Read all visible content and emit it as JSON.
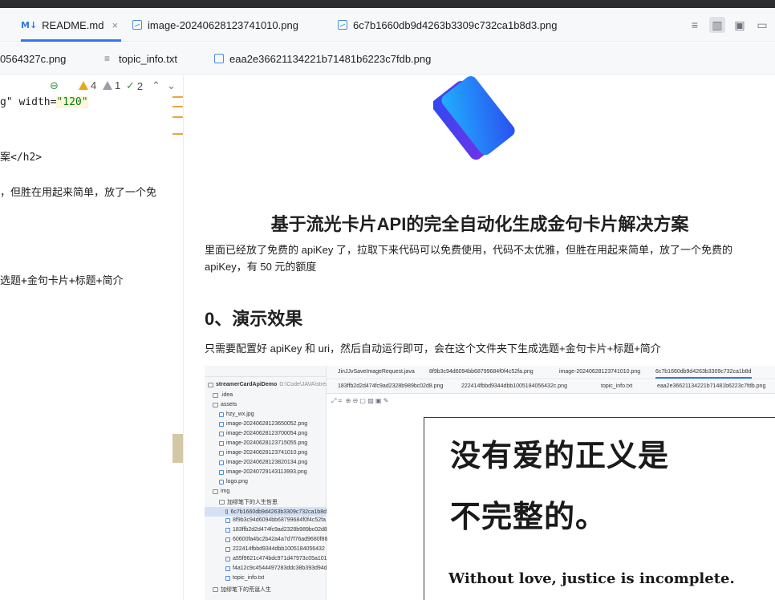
{
  "tabs_row1": [
    {
      "badge": "M↓",
      "label": "README.md",
      "close": "×",
      "active": true
    },
    {
      "label": "image-20240628123741010.png"
    },
    {
      "label": "6c7b1660db9d4263b3309c732ca1b8d3.png"
    }
  ],
  "tabs_row2": [
    {
      "label": "0564327c.png"
    },
    {
      "label": "topic_info.txt"
    },
    {
      "label": "eaa2e36621134221b71481b6223c7fdb.png"
    }
  ],
  "inspections": {
    "warnings": "4",
    "weak_warnings": "1",
    "ok": "2"
  },
  "editor_code": {
    "line1_pre": "g\" width=",
    "line1_str": "\"120\"",
    "line2": "案</h2>",
    "line3": "，但胜在用起来简单，放了一个免",
    "line4": "选题+金句卡片+标题+简介"
  },
  "preview": {
    "title": "基于流光卡片API的完全自动化生成金句卡片解决方案",
    "intro": "里面已经放了免费的 apiKey 了，拉取下来代码可以免费使用，代码不太优雅，但胜在用起来简单，放了一个免费的 apiKey，有 50 元的额度",
    "section_heading": "0、演示效果",
    "section_text": "只需要配置好 apiKey 和 uri，然后自动运行即可，会在这个文件夹下生成选题+金句卡片+标题+简介"
  },
  "screenshot": {
    "project_name": "streamerCardApiDemo",
    "project_path": "D:\\Code\\JAVA\\streamerC",
    "tree": [
      ".idea",
      "assets",
      "hzy_wx.jpg",
      "image-20240628123650052.png",
      "image-20240628123700054.png",
      "image-20240628123715055.png",
      "image-20240628123741010.png",
      "image-20240628123820134.png",
      "image-20240729143113993.png",
      "logo.png",
      "img",
      "加缪笔下的人生哲思",
      "6c7b1660db9d4263b3309c732ca1b8d",
      "8f9b3c94d6094bb68799684f0f4c52fa",
      "183ffb2d2d474fc9ad2328b989bc02d8",
      "60600fa4bc2b42a4a7d7f76ad9680f86",
      "222414fbbd9344dbb1005184056432",
      "a55f9621c474bdc971d47973c05a101",
      "f4a12c9c4544497283ddc38b393d94d",
      "topic_info.txt",
      "加缪笔下的荒诞人生"
    ],
    "tabs1": [
      "JinJJvSaveImageRequest.java",
      "8f9b3c94d6094bb68799684f0f4c52fa.png",
      "image-20240628123741010.png",
      "6c7b1660db9d4263b3309c732ca1b8d"
    ],
    "tabs2": [
      "183ffb2d2d474fc9ad2328b989bc02d8.png",
      "222414fbbd9344dbb1005184056432c.png",
      "topic_info.txt",
      "eaa2e36621134221b71481b6223c7fdb.png"
    ],
    "card_line1": "没有爱的正义是",
    "card_line2": "不完整的。",
    "card_english": "Without love, justice is incomplete."
  },
  "colors": {
    "accent": "#3574f0",
    "logo_blue": "#1f5cf0",
    "logo_purple": "#8a2be2",
    "warning": "#e6a817"
  }
}
